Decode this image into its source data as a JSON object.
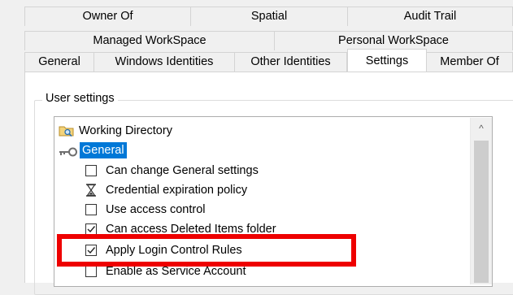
{
  "tabs": {
    "row1": [
      "Owner Of",
      "Spatial",
      "Audit Trail"
    ],
    "row2": [
      "Managed WorkSpace",
      "Personal WorkSpace"
    ],
    "row3": [
      "General",
      "Windows Identities",
      "Other Identities",
      "Settings",
      "Member Of"
    ],
    "active": "Settings"
  },
  "group": {
    "label": "User settings"
  },
  "tree": {
    "items": [
      {
        "label": "Working Directory",
        "icon": "folder-search-icon"
      },
      {
        "label": "General",
        "icon": "key-icon",
        "selected": true
      },
      {
        "label": "Can change General settings",
        "icon": "checkbox",
        "checked": false
      },
      {
        "label": "Credential expiration policy",
        "icon": "hourglass-icon"
      },
      {
        "label": "Use access control",
        "icon": "checkbox",
        "checked": false
      },
      {
        "label": "Can access Deleted Items folder",
        "icon": "checkbox",
        "checked": true
      },
      {
        "label": "Apply Login Control Rules",
        "icon": "checkbox",
        "checked": true
      },
      {
        "label": "Enable as Service Account",
        "icon": "checkbox",
        "checked": false
      }
    ]
  },
  "highlight_color": "#ee0000",
  "selection_color": "#0078d7"
}
